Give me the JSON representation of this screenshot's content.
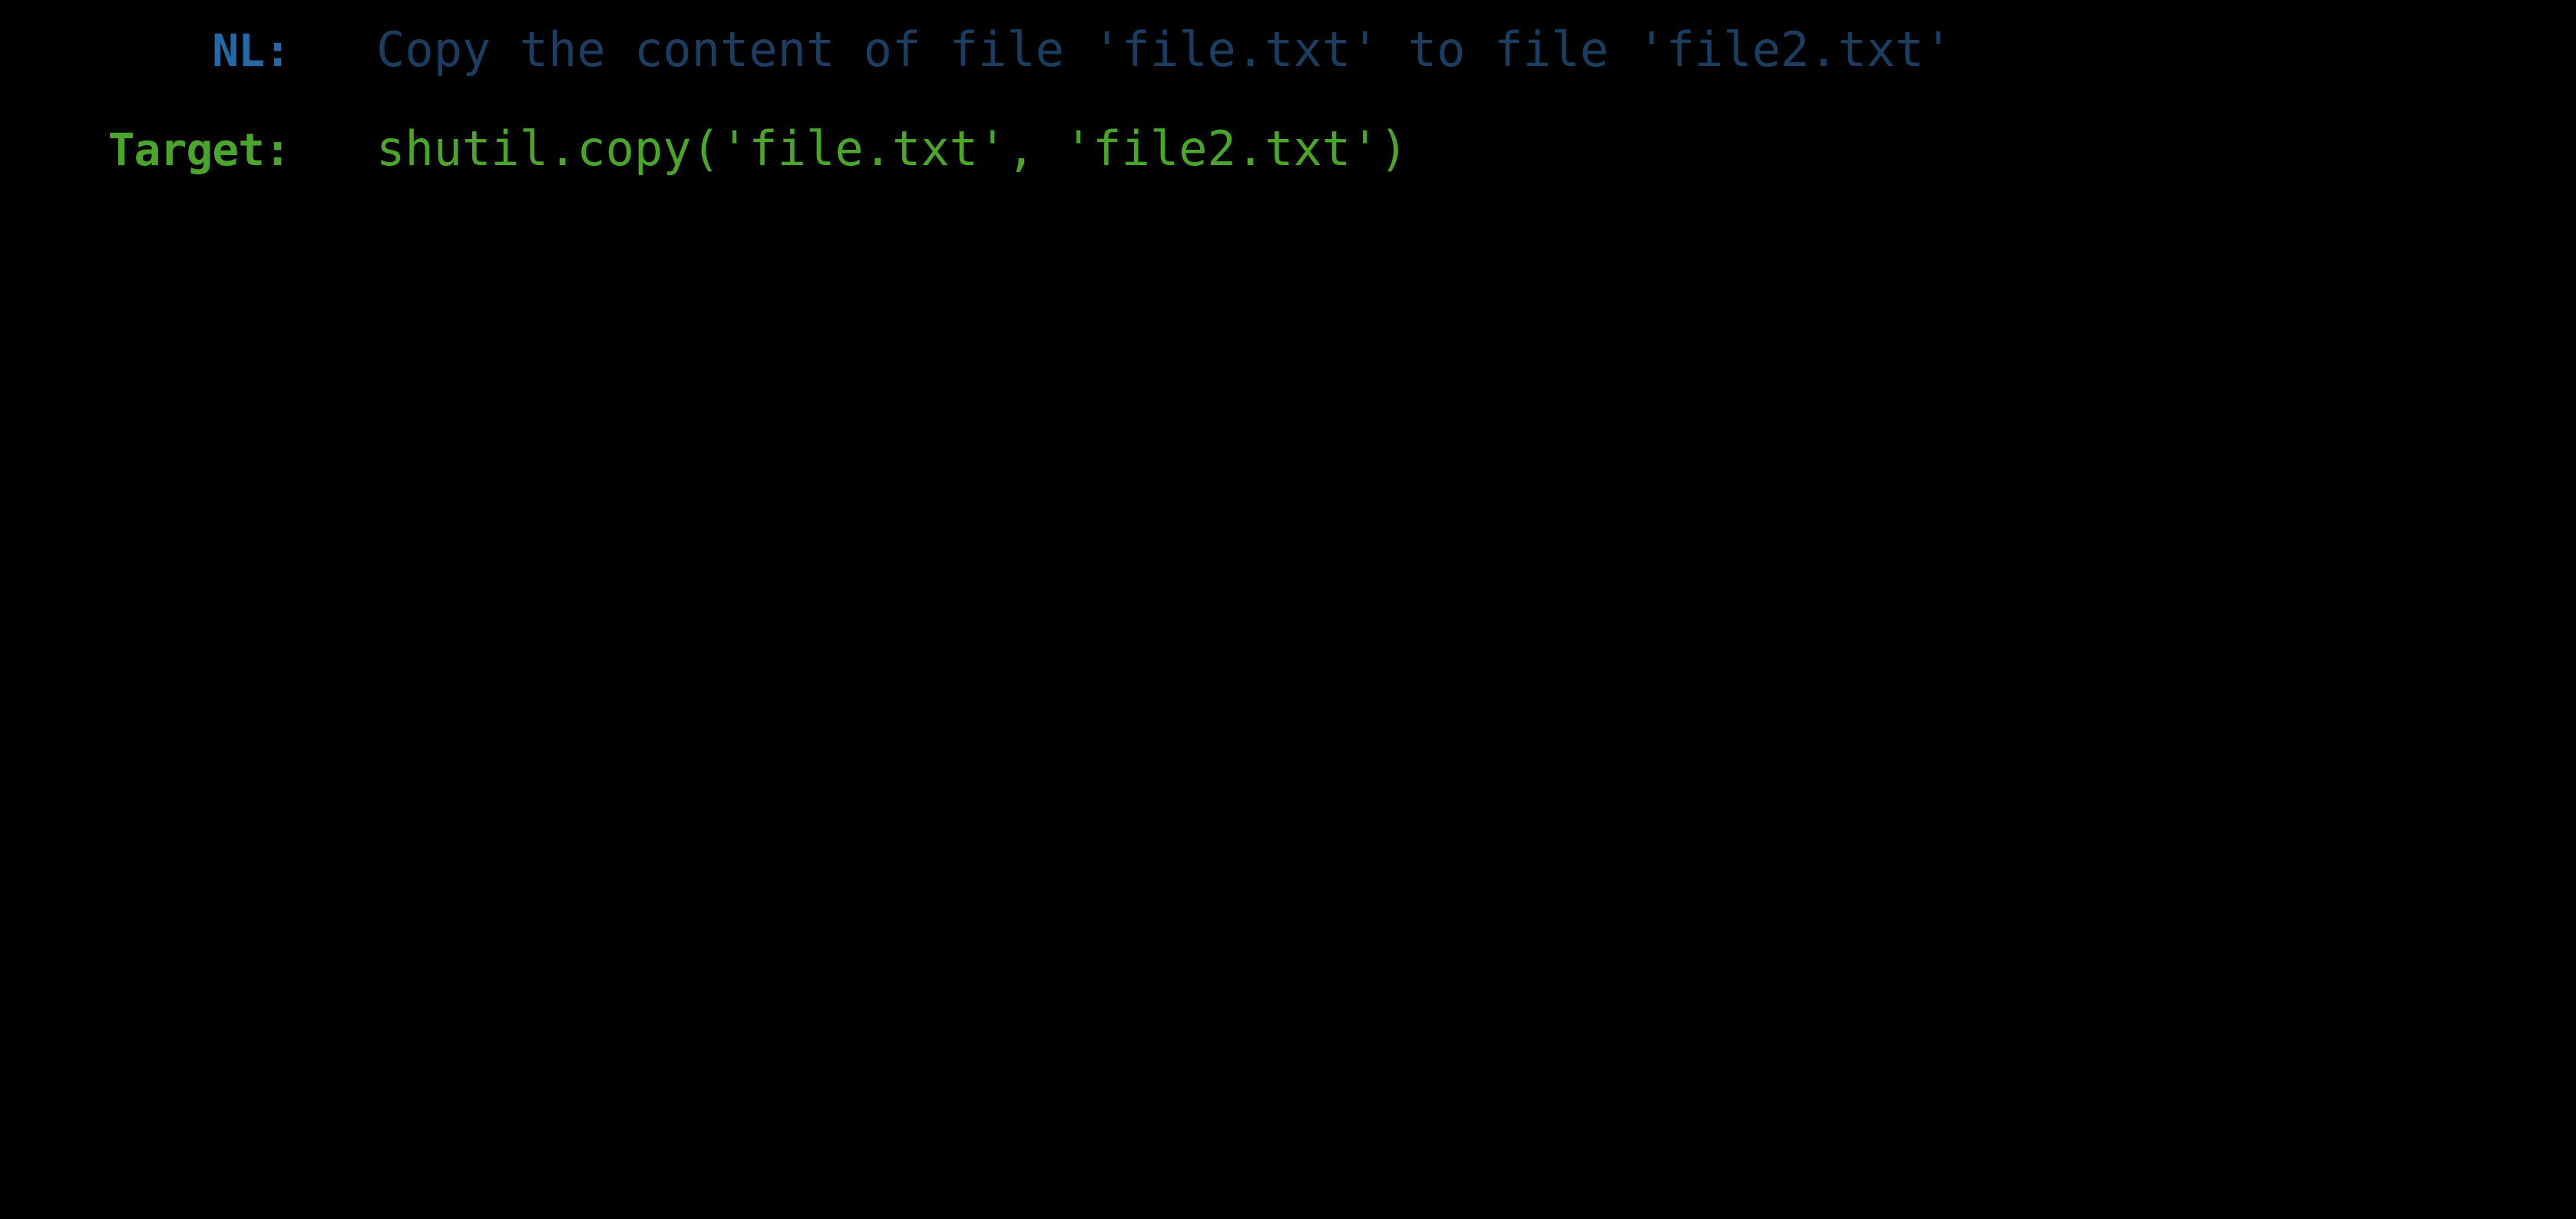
{
  "background_color": "#000000",
  "lines": [
    {
      "id": "nl",
      "label": "NL:",
      "label_color": "#2469a6",
      "value": "Copy the content of file 'file.txt' to file 'file2.txt'",
      "value_color": "#1b3d61"
    },
    {
      "id": "target",
      "label": "Target:",
      "label_color": "#4ba52c",
      "value": "shutil.copy('file.txt', 'file2.txt')",
      "value_color": "#4ba52c"
    }
  ]
}
